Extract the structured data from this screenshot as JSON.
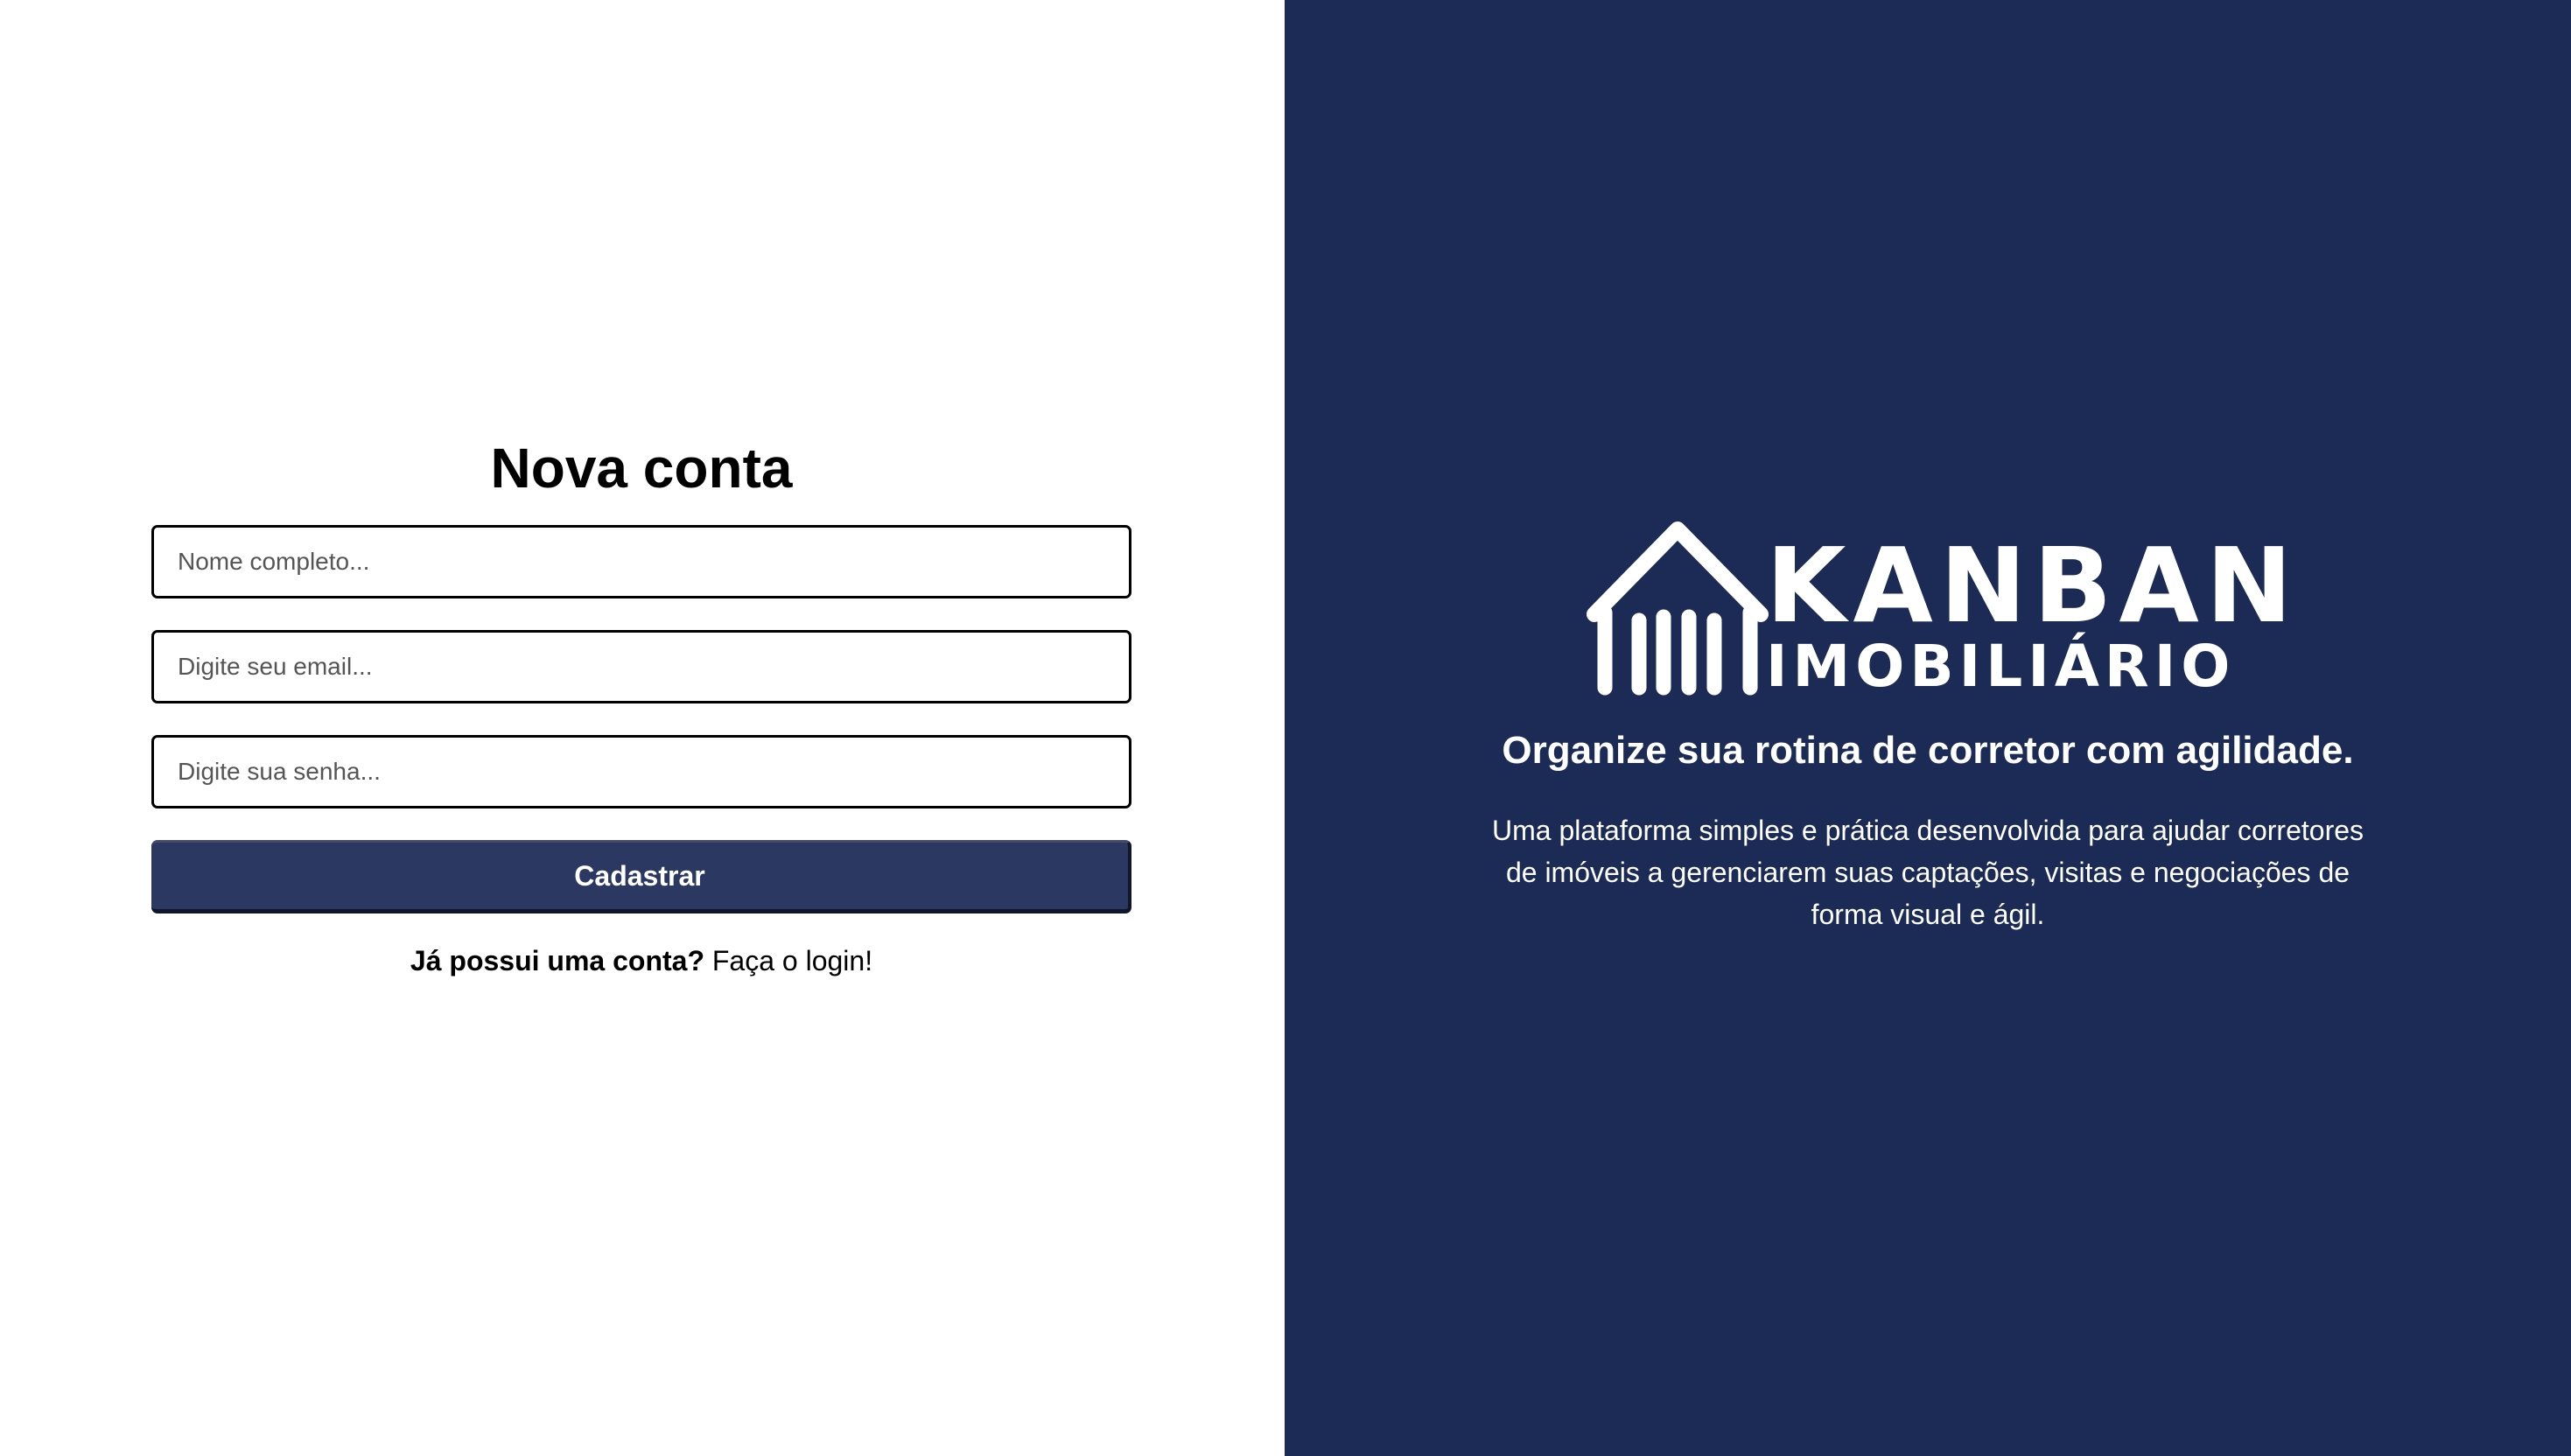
{
  "register": {
    "title": "Nova conta",
    "name_placeholder": "Nome completo...",
    "email_placeholder": "Digite seu email...",
    "password_placeholder": "Digite sua senha...",
    "submit_label": "Cadastrar",
    "login_question": "Já possui uma conta?",
    "login_link": "Faça o login!"
  },
  "brand": {
    "logo_word_1": "KANBAN",
    "logo_word_2": "IMOBILIÁRIO",
    "logo_icon": "house-icon",
    "tagline": "Organize sua rotina de corretor com agilidade.",
    "description": "Uma plataforma simples e prática desenvolvida para ajudar corretores de imóveis a gerenciarem suas captações, visitas e negociações de forma visual e ágil."
  },
  "colors": {
    "brand_panel": "#1b2b55",
    "button": "#2b3862",
    "page_background": "#ffffff"
  }
}
